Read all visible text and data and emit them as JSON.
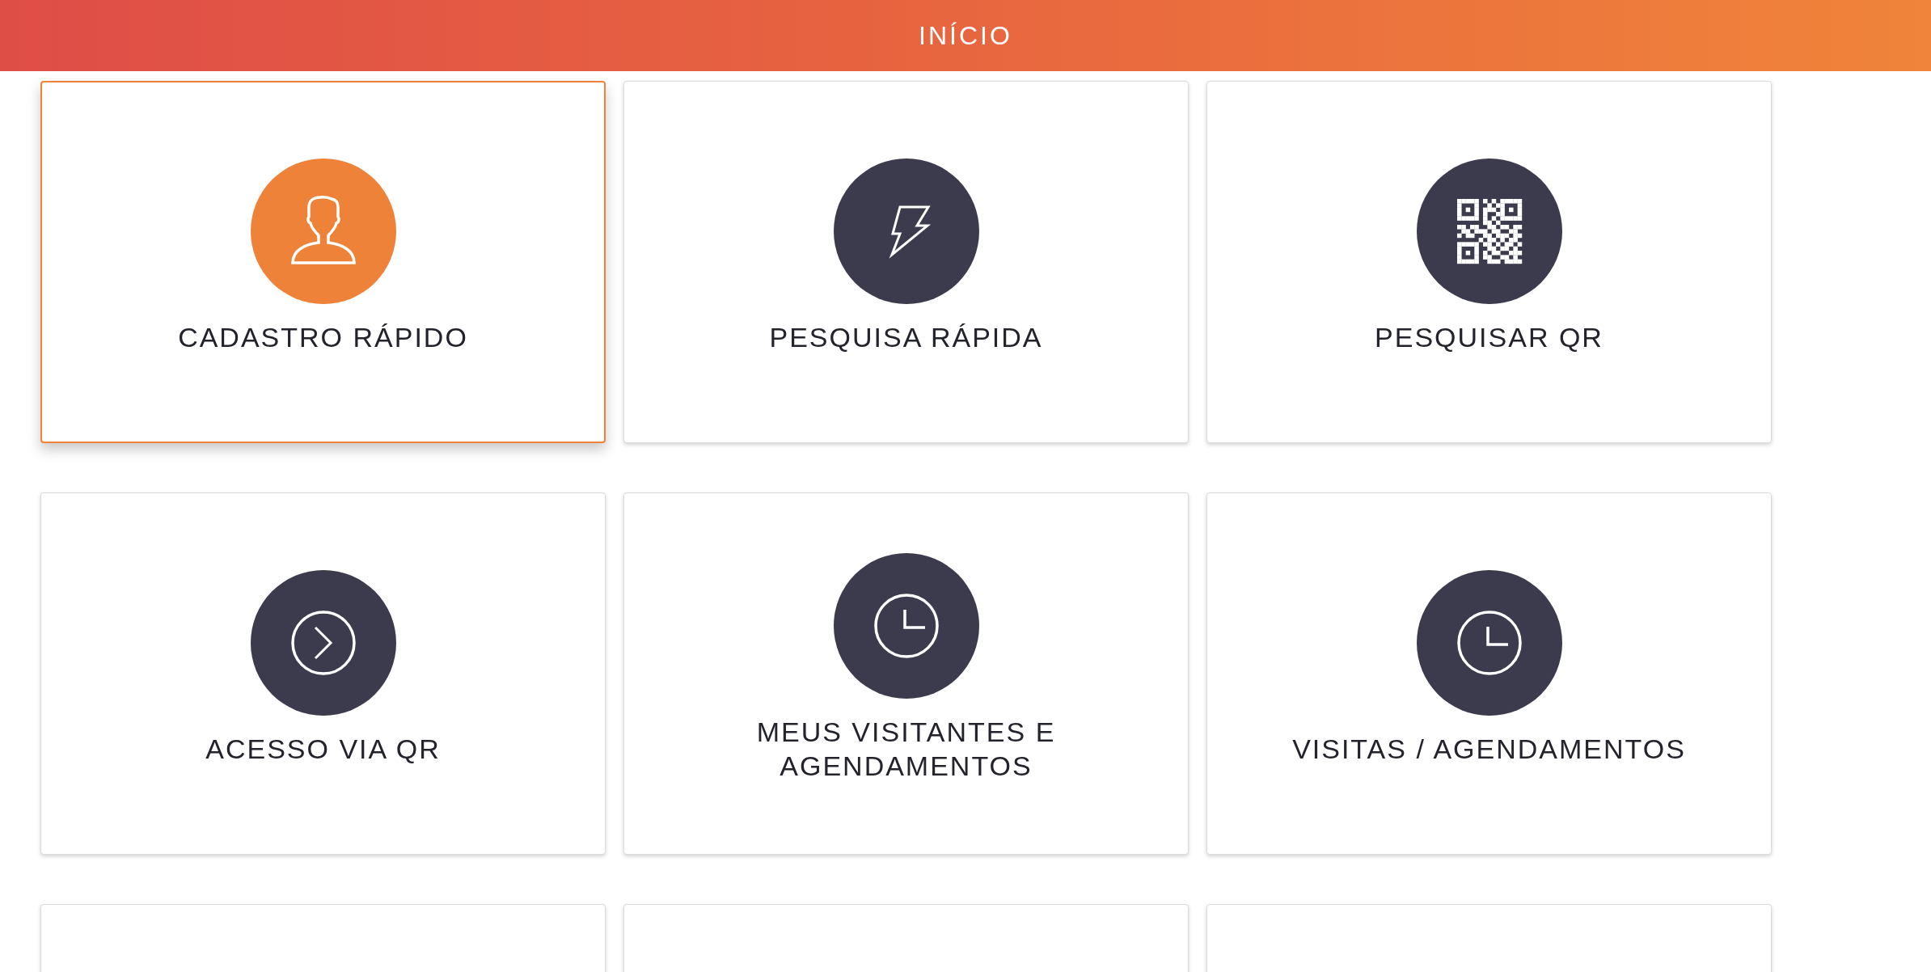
{
  "header": {
    "title": "INÍCIO"
  },
  "tiles": [
    {
      "label": "CADASTRO RÁPIDO",
      "selected": true
    },
    {
      "label": "PESQUISA RÁPIDA",
      "selected": false
    },
    {
      "label": "PESQUISAR QR",
      "selected": false
    },
    {
      "label": "ACESSO VIA QR",
      "selected": false
    },
    {
      "label": "MEUS VISITANTES E AGENDAMENTOS",
      "selected": false
    },
    {
      "label": "VISITAS / AGENDAMENTOS",
      "selected": false
    },
    {
      "selected": false
    },
    {
      "selected": false
    },
    {
      "selected": false
    }
  ]
}
